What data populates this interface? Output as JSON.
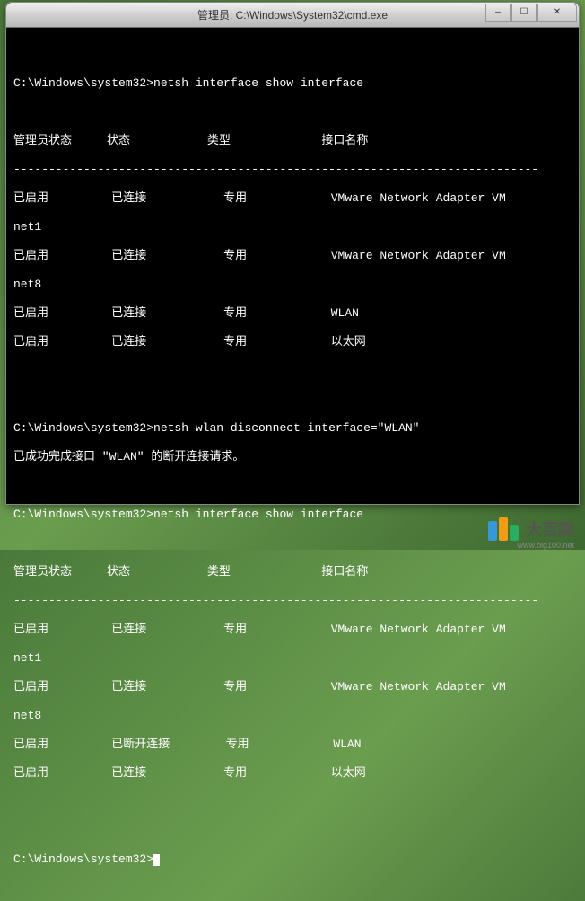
{
  "window": {
    "title": "管理员: C:\\Windows\\System32\\cmd.exe",
    "controls": {
      "min": "—",
      "max": "☐",
      "close": "✕"
    }
  },
  "terminal": {
    "prompt": "C:\\Windows\\system32>",
    "cmd1": "netsh interface show interface",
    "headers": {
      "admin_state": "管理员状态",
      "state": "状态",
      "type": "类型",
      "iface": "接口名称"
    },
    "divider": "---------------------------------------------------------------------------",
    "rows1": [
      {
        "admin": "已启用",
        "state": "已连接",
        "type": "专用",
        "iface": "VMware Network Adapter VM",
        "sub": "net1"
      },
      {
        "admin": "已启用",
        "state": "已连接",
        "type": "专用",
        "iface": "VMware Network Adapter VM",
        "sub": "net8"
      },
      {
        "admin": "已启用",
        "state": "已连接",
        "type": "专用",
        "iface": "WLAN",
        "sub": ""
      },
      {
        "admin": "已启用",
        "state": "已连接",
        "type": "专用",
        "iface": "以太网",
        "sub": ""
      }
    ],
    "cmd2": "netsh wlan disconnect interface=\"WLAN\"",
    "msg2": "已成功完成接口 \"WLAN\" 的断开连接请求。",
    "cmd3": "netsh interface show interface",
    "rows2": [
      {
        "admin": "已启用",
        "state": "已连接",
        "type": "专用",
        "iface": "VMware Network Adapter VM",
        "sub": "net1"
      },
      {
        "admin": "已启用",
        "state": "已连接",
        "type": "专用",
        "iface": "VMware Network Adapter VM",
        "sub": "net8"
      },
      {
        "admin": "已启用",
        "state": "已断开连接",
        "type": "专用",
        "iface": "WLAN",
        "sub": ""
      },
      {
        "admin": "已启用",
        "state": "已连接",
        "type": "专用",
        "iface": "以太网",
        "sub": ""
      }
    ]
  },
  "watermark": {
    "text": "大百网",
    "url": "www.big100.net"
  }
}
